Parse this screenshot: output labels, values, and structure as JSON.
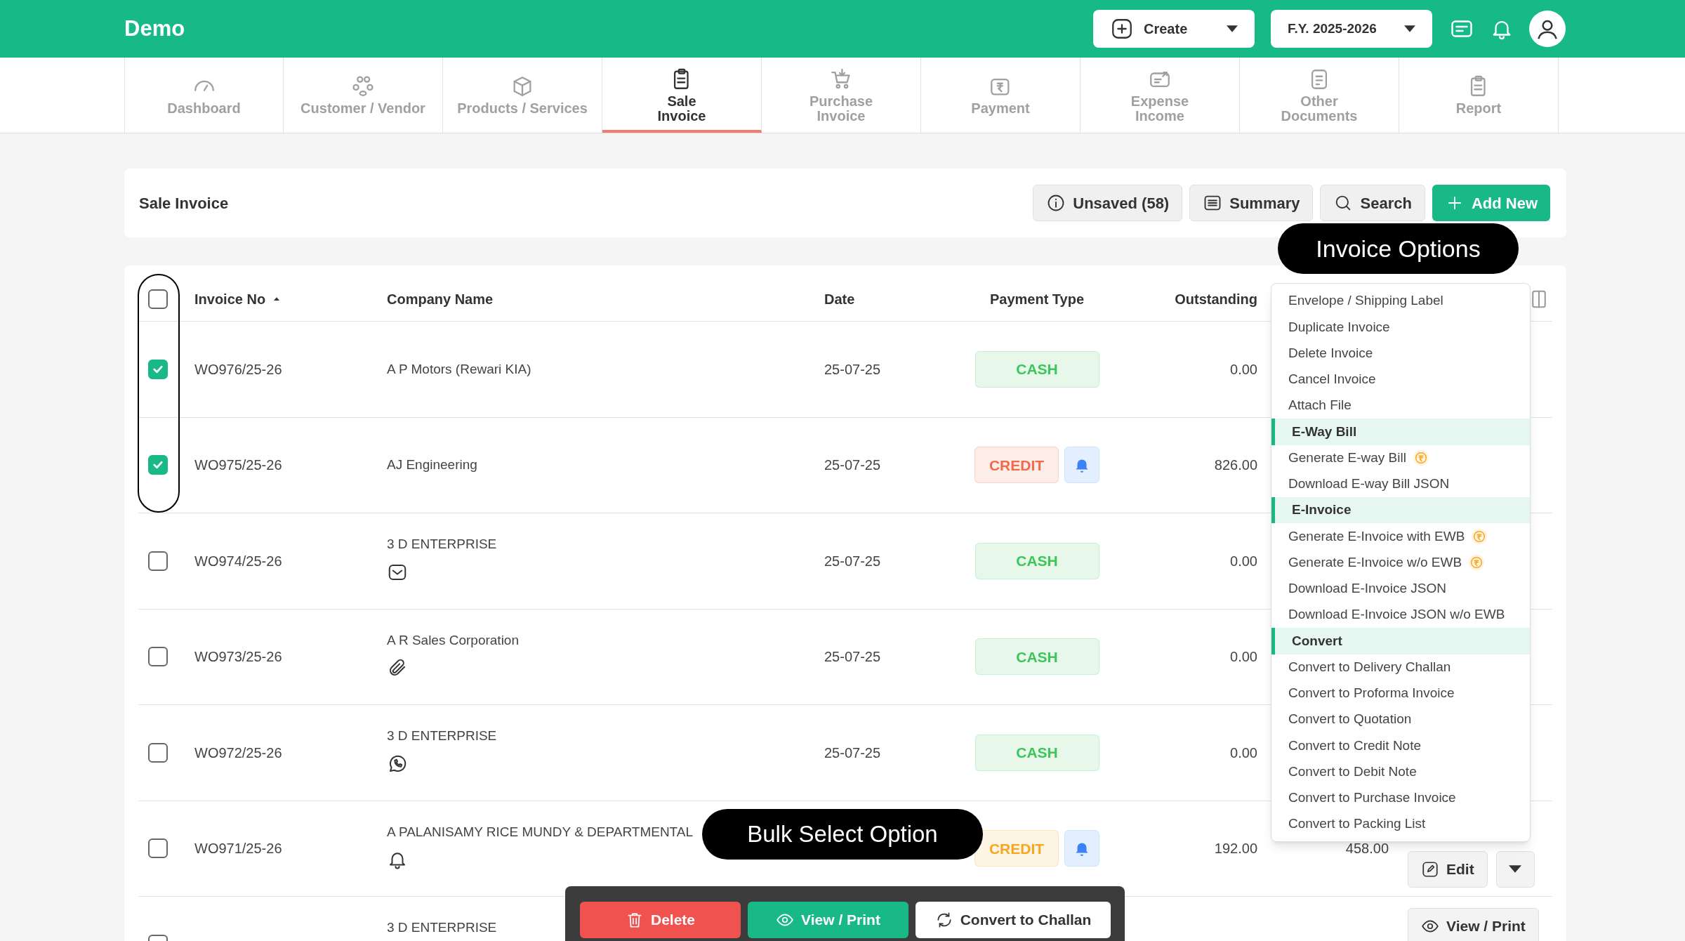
{
  "app": {
    "title": "Demo"
  },
  "topbar": {
    "create_button": "Create",
    "fy_button": "F.Y. 2025-2026"
  },
  "tabs": [
    {
      "label": "Dashboard",
      "selected": false
    },
    {
      "label": "Customer / Vendor",
      "selected": false
    },
    {
      "label": "Products / Services",
      "selected": false
    },
    {
      "label": "Sale\nInvoice",
      "selected": true
    },
    {
      "label": "Purchase\nInvoice",
      "selected": false
    },
    {
      "label": "Payment",
      "selected": false
    },
    {
      "label": "Expense\nIncome",
      "selected": false
    },
    {
      "label": "Other\nDocuments",
      "selected": false
    },
    {
      "label": "Report",
      "selected": false
    }
  ],
  "page": {
    "title": "Sale Invoice",
    "buttons": [
      {
        "kind": "info",
        "label": "Unsaved (58)"
      },
      {
        "kind": "summary",
        "label": "Summary"
      },
      {
        "kind": "search",
        "label": "Search"
      },
      {
        "kind": "add",
        "label": "Add New"
      }
    ]
  },
  "table": {
    "select_all": {
      "checked": false
    },
    "columns": [
      "Invoice No",
      "Company Name",
      "Date",
      "Payment Type",
      "Outstanding"
    ],
    "rows": [
      {
        "checked": true,
        "invoice_no": "WO976/25-26",
        "company": "A P Motors (Rewari KIA)",
        "date": "25-07-25",
        "payment": {
          "label": "CASH",
          "color": "#3cc65a"
        },
        "reminder": false,
        "outstanding": "0.00"
      },
      {
        "checked": true,
        "invoice_no": "WO975/25-26",
        "company": "AJ Engineering",
        "date": "25-07-25",
        "payment": {
          "label": "CREDIT",
          "color": "#f26a4b"
        },
        "reminder": true,
        "outstanding": "826.00"
      },
      {
        "checked": false,
        "invoice_no": "WO974/25-26",
        "company": "3 D ENTERPRISE",
        "note": {
          "kind": "email"
        },
        "date": "25-07-25",
        "payment": {
          "label": "CASH",
          "color": "#3cc65a"
        },
        "reminder": false,
        "outstanding": "0.00"
      },
      {
        "checked": false,
        "invoice_no": "WO973/25-26",
        "company": "A R Sales Corporation",
        "note": {
          "kind": "attachment"
        },
        "date": "25-07-25",
        "payment": {
          "label": "CASH",
          "color": "#3cc65a"
        },
        "reminder": false,
        "outstanding": "0.00"
      },
      {
        "checked": false,
        "invoice_no": "WO972/25-26",
        "company": "3 D ENTERPRISE",
        "note": {
          "kind": "whatsapp"
        },
        "date": "25-07-25",
        "payment": {
          "label": "CASH",
          "color": "#3cc65a"
        },
        "reminder": false,
        "outstanding": "0.00"
      },
      {
        "checked": false,
        "invoice_no": "WO971/25-26",
        "company": "A PALANISAMY RICE MUNDY & DEPARTMENTAL",
        "note": {
          "kind": "reminder"
        },
        "payment": {
          "label": "CREDIT",
          "color": "#f5a623"
        },
        "reminder": true,
        "outstanding": "192.00",
        "column_7": "458.00",
        "actions": [
          {
            "kind": "edit",
            "label": "Edit"
          },
          {
            "kind": "dropdown"
          }
        ]
      },
      {
        "checked": false,
        "company": "3 D ENTERPRISE",
        "actions": [
          {
            "kind": "view",
            "label": "View / Print"
          }
        ]
      }
    ]
  },
  "invoice_options_menu": {
    "items": [
      {
        "kind": "item",
        "label": "Envelope / Shipping Label",
        "premium": false
      },
      {
        "kind": "item",
        "label": "Duplicate Invoice",
        "premium": false
      },
      {
        "kind": "item",
        "label": "Delete Invoice",
        "premium": false
      },
      {
        "kind": "item",
        "label": "Cancel Invoice",
        "premium": false
      },
      {
        "kind": "item",
        "label": "Attach File",
        "premium": false
      },
      {
        "kind": "section",
        "label": "E-Way Bill",
        "premium": false
      },
      {
        "kind": "item",
        "label": "Generate E-way Bill",
        "premium": true
      },
      {
        "kind": "item",
        "label": "Download E-way Bill JSON",
        "premium": false
      },
      {
        "kind": "section",
        "label": "E-Invoice",
        "premium": false
      },
      {
        "kind": "item",
        "label": "Generate E-Invoice with EWB",
        "premium": true
      },
      {
        "kind": "item",
        "label": "Generate E-Invoice w/o EWB",
        "premium": true
      },
      {
        "kind": "item",
        "label": "Download E-Invoice JSON",
        "premium": false
      },
      {
        "kind": "item",
        "label": "Download E-Invoice JSON w/o EWB",
        "premium": false
      },
      {
        "kind": "section",
        "label": "Convert",
        "premium": false
      },
      {
        "kind": "item",
        "label": "Convert to Delivery Challan",
        "premium": false
      },
      {
        "kind": "item",
        "label": "Convert to Proforma Invoice",
        "premium": false
      },
      {
        "kind": "item",
        "label": "Convert to Quotation",
        "premium": false
      },
      {
        "kind": "item",
        "label": "Convert to Credit Note",
        "premium": false
      },
      {
        "kind": "item",
        "label": "Convert to Debit Note",
        "premium": false
      },
      {
        "kind": "item",
        "label": "Convert to Purchase Invoice",
        "premium": false
      },
      {
        "kind": "item",
        "label": "Convert to Packing List",
        "premium": false
      }
    ]
  },
  "bulk_actions": [
    {
      "kind": "delete",
      "label": "Delete"
    },
    {
      "kind": "view",
      "label": "View / Print"
    },
    {
      "kind": "convert",
      "label": "Convert to Challan"
    }
  ],
  "annotations": [
    {
      "text": "Invoice Options"
    },
    {
      "text": "Bulk Select Option"
    }
  ]
}
